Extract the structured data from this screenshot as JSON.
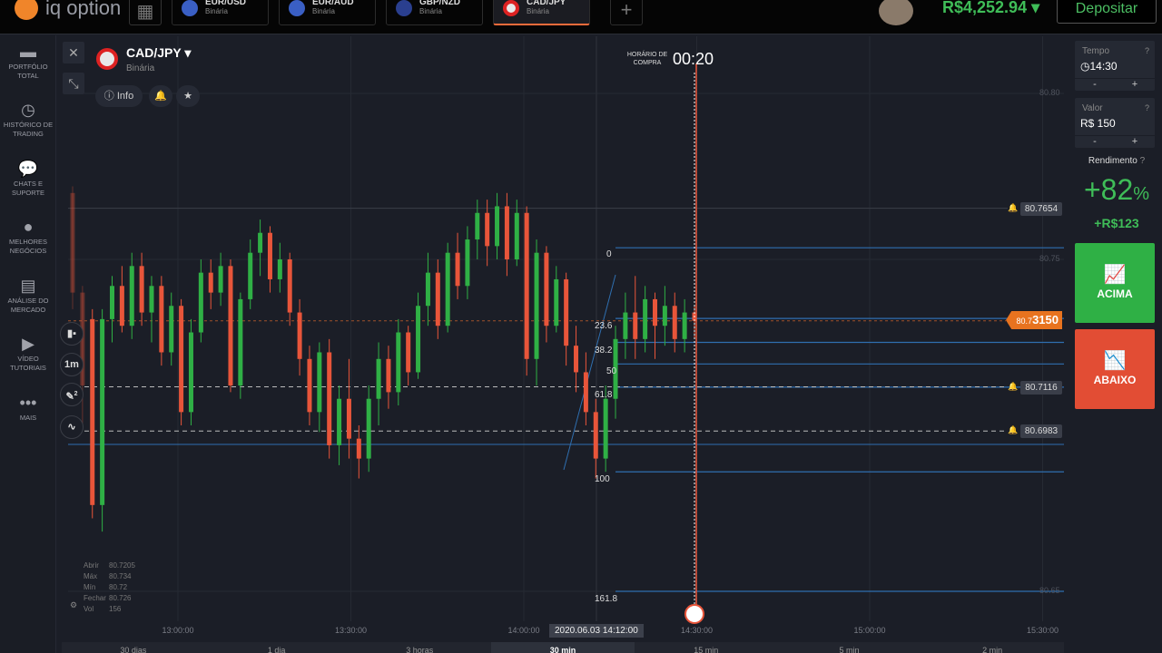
{
  "topbar": {
    "logo_text": "iq option",
    "tabs": [
      {
        "pair": "EUR/USD",
        "type": "Binária"
      },
      {
        "pair": "EUR/AUD",
        "type": "Binária"
      },
      {
        "pair": "GBP/NZD",
        "type": "Binária"
      },
      {
        "pair": "CAD/JPY",
        "type": "Binária"
      }
    ],
    "add_tab": "+",
    "balance": "R$4,252.94 ▾",
    "deposit": "Depositar"
  },
  "sidebar": {
    "items": [
      {
        "icon": "briefcase",
        "label": "PORTFÓLIO TOTAL"
      },
      {
        "icon": "history",
        "label": "HISTÓRICO DE TRADING"
      },
      {
        "icon": "chat",
        "label": "CHATS E SUPORTE"
      },
      {
        "icon": "medal",
        "label": "MELHORES NEGÓCIOS"
      },
      {
        "icon": "newspaper",
        "label": "ANÁLISE DO MERCADO"
      },
      {
        "icon": "play",
        "label": "VÍDEO TUTORIAIS"
      },
      {
        "icon": "dots",
        "label": "MAIS"
      }
    ]
  },
  "asset": {
    "title": "CAD/JPY ▾",
    "subtitle": "Binária",
    "info": "Info"
  },
  "tools": {
    "timeframe": "1m",
    "drawings_count": "2"
  },
  "purchase": {
    "label": "HORÁRIO DE COMPRA",
    "timer": "00:20"
  },
  "ohlc": {
    "rows": [
      {
        "k": "Abrir",
        "v": "80.7205"
      },
      {
        "k": "Máx",
        "v": "80.734"
      },
      {
        "k": "Mín",
        "v": "80.72"
      },
      {
        "k": "Fechar",
        "v": "80.726"
      },
      {
        "k": "Vol",
        "v": "156"
      }
    ]
  },
  "chart_data": {
    "type": "candlestick",
    "ylim": [
      80.64,
      80.81
    ],
    "price_ticks": [
      "80.80",
      "80.75",
      "80.65"
    ],
    "price_tick_values": [
      80.8,
      80.75,
      80.65
    ],
    "time_ticks": [
      "13:00:00",
      "13:30:00",
      "14:00:00",
      "14:30:00",
      "15:00:00",
      "15:30:00"
    ],
    "cursor_time": "2020.06.03 14:12:00",
    "current_price_prefix": "80.7",
    "current_price_suffix": "3150",
    "current_price": 80.7315,
    "alerts": [
      {
        "label": "80.7654",
        "price": 80.7654,
        "dashed": false
      },
      {
        "label": "80.7116",
        "price": 80.7116,
        "dashed": true
      },
      {
        "label": "80.6983",
        "price": 80.6983,
        "dashed": true
      }
    ],
    "fib_levels": [
      {
        "label": "0",
        "price": 80.7535
      },
      {
        "label": "23.6",
        "price": 80.7322
      },
      {
        "label": "38.2",
        "price": 80.725
      },
      {
        "label": "50",
        "price": 80.7185
      },
      {
        "label": "61.8",
        "price": 80.7115
      },
      {
        "label": "100",
        "price": 80.686
      },
      {
        "label": "161.8",
        "price": 80.65
      }
    ],
    "colors": {
      "up": "#2fb045",
      "down": "#e8553a",
      "fib": "#2f6fb0",
      "expiry": "#e8553a"
    },
    "candles": [
      [
        80.77,
        80.772,
        80.735,
        80.74
      ],
      [
        80.74,
        80.742,
        80.7,
        80.712
      ],
      [
        80.732,
        80.735,
        80.672,
        80.676
      ],
      [
        80.676,
        80.735,
        80.668,
        80.732
      ],
      [
        80.732,
        80.745,
        80.725,
        80.742
      ],
      [
        80.742,
        80.748,
        80.728,
        80.73
      ],
      [
        80.73,
        80.752,
        80.726,
        80.748
      ],
      [
        80.748,
        80.752,
        80.73,
        80.734
      ],
      [
        80.734,
        80.745,
        80.725,
        80.742
      ],
      [
        80.742,
        80.745,
        80.718,
        80.722
      ],
      [
        80.722,
        80.74,
        80.718,
        80.736
      ],
      [
        80.736,
        80.738,
        80.7,
        80.704
      ],
      [
        80.704,
        80.732,
        80.7,
        80.728
      ],
      [
        80.728,
        80.75,
        80.725,
        80.746
      ],
      [
        80.746,
        80.75,
        80.735,
        80.74
      ],
      [
        80.74,
        80.752,
        80.736,
        80.748
      ],
      [
        80.748,
        80.75,
        80.71,
        80.712
      ],
      [
        80.712,
        80.74,
        80.708,
        80.738
      ],
      [
        80.738,
        80.756,
        80.735,
        80.752
      ],
      [
        80.752,
        80.762,
        80.745,
        80.758
      ],
      [
        80.758,
        80.76,
        80.74,
        80.744
      ],
      [
        80.744,
        80.755,
        80.74,
        80.75
      ],
      [
        80.75,
        80.752,
        80.73,
        80.734
      ],
      [
        80.734,
        80.738,
        80.715,
        80.72
      ],
      [
        80.72,
        80.724,
        80.7,
        80.704
      ],
      [
        80.704,
        80.725,
        80.698,
        80.722
      ],
      [
        80.722,
        80.726,
        80.69,
        80.694
      ],
      [
        80.694,
        80.712,
        80.688,
        80.708
      ],
      [
        80.708,
        80.72,
        80.69,
        80.696
      ],
      [
        80.696,
        80.7,
        80.684,
        80.69
      ],
      [
        80.69,
        80.712,
        80.686,
        80.708
      ],
      [
        80.708,
        80.725,
        80.7,
        80.72
      ],
      [
        80.72,
        80.724,
        80.705,
        80.71
      ],
      [
        80.71,
        80.732,
        80.706,
        80.728
      ],
      [
        80.728,
        80.73,
        80.712,
        80.716
      ],
      [
        80.716,
        80.74,
        80.714,
        80.736
      ],
      [
        80.736,
        80.752,
        80.73,
        80.746
      ],
      [
        80.746,
        80.75,
        80.726,
        80.73
      ],
      [
        80.73,
        80.755,
        80.728,
        80.752
      ],
      [
        80.752,
        80.758,
        80.738,
        80.742
      ],
      [
        80.742,
        80.76,
        80.738,
        80.756
      ],
      [
        80.756,
        80.768,
        80.75,
        80.764
      ],
      [
        80.764,
        80.768,
        80.748,
        80.754
      ],
      [
        80.754,
        80.77,
        80.75,
        80.766
      ],
      [
        80.766,
        80.77,
        80.745,
        80.75
      ],
      [
        80.75,
        80.768,
        80.748,
        80.764
      ],
      [
        80.764,
        80.766,
        80.715,
        80.72
      ],
      [
        80.72,
        80.756,
        80.712,
        80.752
      ],
      [
        80.752,
        80.754,
        80.725,
        80.73
      ],
      [
        80.73,
        80.748,
        80.728,
        80.744
      ],
      [
        80.744,
        80.746,
        80.718,
        80.724
      ],
      [
        80.724,
        80.73,
        80.71,
        80.716
      ],
      [
        80.716,
        80.722,
        80.7,
        80.704
      ],
      [
        80.704,
        80.708,
        80.684,
        80.69
      ],
      [
        80.69,
        80.712,
        80.686,
        80.708
      ],
      [
        80.708,
        80.73,
        80.702,
        80.726
      ],
      [
        80.726,
        80.74,
        80.72,
        80.734
      ],
      [
        80.734,
        80.745,
        80.72,
        80.726
      ],
      [
        80.726,
        80.742,
        80.722,
        80.738
      ],
      [
        80.738,
        80.74,
        80.72,
        80.73
      ],
      [
        80.73,
        80.742,
        80.724,
        80.736
      ],
      [
        80.736,
        80.74,
        80.722,
        80.726
      ],
      [
        80.726,
        80.738,
        80.722,
        80.734
      ],
      [
        80.734,
        80.736,
        80.726,
        80.7315
      ]
    ]
  },
  "timeframes": [
    "30 dias",
    "1 dia",
    "3 horas",
    "30 min",
    "15 min",
    "5 min",
    "2 min"
  ],
  "active_timeframe": 3,
  "right_panel": {
    "time": {
      "label": "Tempo",
      "value": "14:30",
      "minus": "-",
      "plus": "+"
    },
    "amount": {
      "label": "Valor",
      "value": "R$ 150",
      "minus": "-",
      "plus": "+"
    },
    "payout_label": "Rendimento",
    "payout_pct": "+82",
    "payout_pct_sign": "%",
    "payout_value": "+R$123",
    "up_label": "ACIMA",
    "down_label": "ABAIXO"
  }
}
